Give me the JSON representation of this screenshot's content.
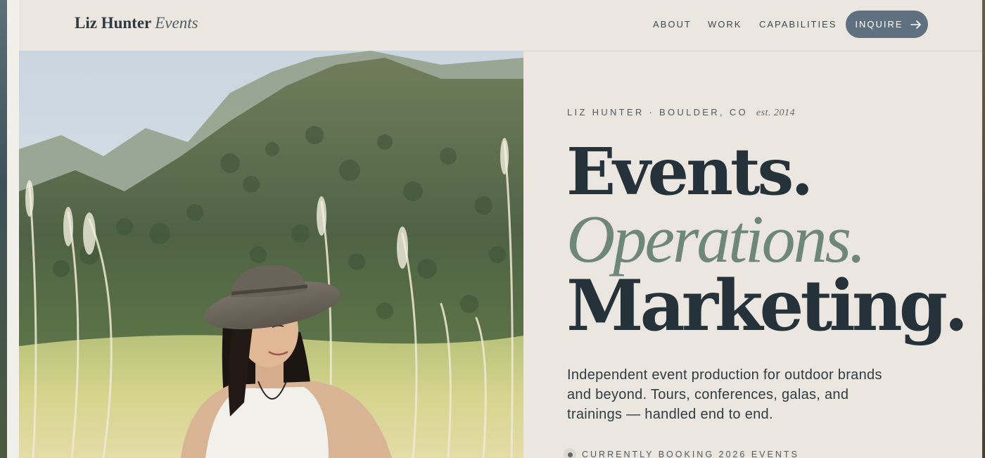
{
  "brand": {
    "name": "Liz Hunter",
    "sub": "Events"
  },
  "nav": {
    "items": [
      {
        "label": "ABOUT"
      },
      {
        "label": "WORK"
      },
      {
        "label": "CAPABILITIES"
      }
    ],
    "cta_label": "INQUIRE",
    "cta_icon": "arrow-right-icon"
  },
  "hero": {
    "kicker": "LIZ HUNTER · BOULDER, CO",
    "est": "est. 2014",
    "headline": [
      "Events.",
      "Operations.",
      "Marketing."
    ],
    "blurb": "Independent event production for outdoor brands and beyond. Tours, conferences, galas, and trainings — handled end to end.",
    "status": "CURRENTLY BOOKING 2026 EVENTS"
  },
  "colors": {
    "background": "#ebe6df",
    "text": "#25323a",
    "accent_green": "#6f8778",
    "button": "#5f7180"
  }
}
